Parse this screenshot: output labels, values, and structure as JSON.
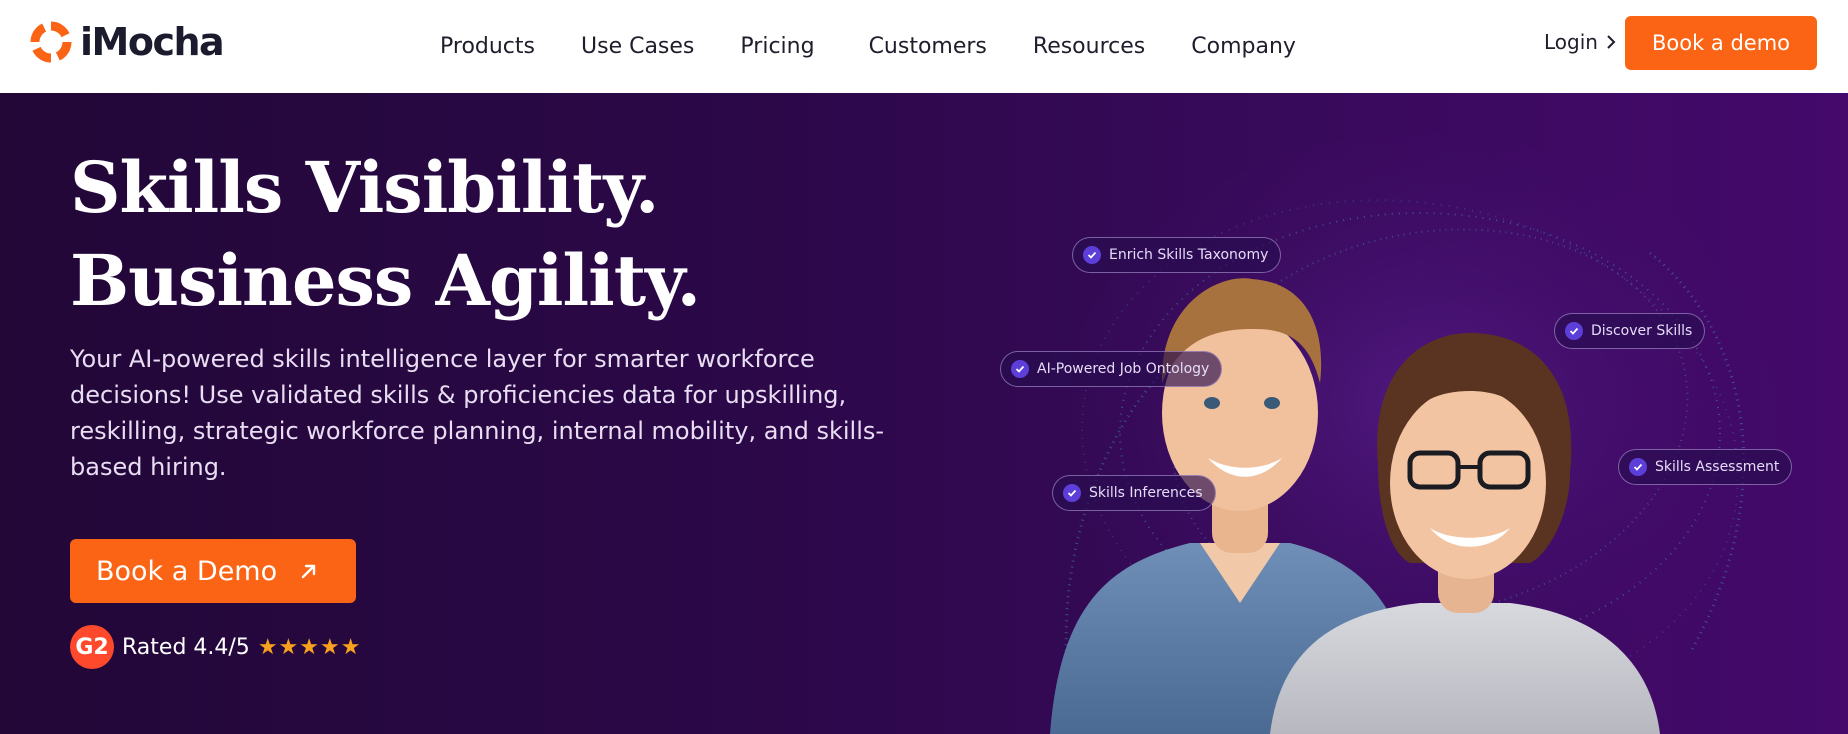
{
  "brand": {
    "name": "iMocha",
    "accent": "#fa6414",
    "hero_bg": "#2b0848"
  },
  "nav": {
    "items": [
      "Products",
      "Use Cases",
      "Pricing",
      "Customers",
      "Resources",
      "Company"
    ],
    "login": "Login",
    "cta": "Book a demo"
  },
  "hero": {
    "title_line1": "Skills Visibility.",
    "title_line2": "Business Agility.",
    "subtitle": "Your AI-powered skills intelligence layer for smarter workforce decisions! Use validated skills & proficiencies data for upskilling, reskilling, strategic workforce planning, internal mobility, and skills-based hiring.",
    "cta": "Book a Demo",
    "rating_badge": "G2",
    "rating_text": "Rated 4.4/5",
    "stars": "★★★★★"
  },
  "visual": {
    "tags": [
      "Enrich Skills Taxonomy",
      "Discover Skills",
      "AI-Powered Job Ontology",
      "Skills Assessment",
      "Skills Inferences"
    ]
  }
}
